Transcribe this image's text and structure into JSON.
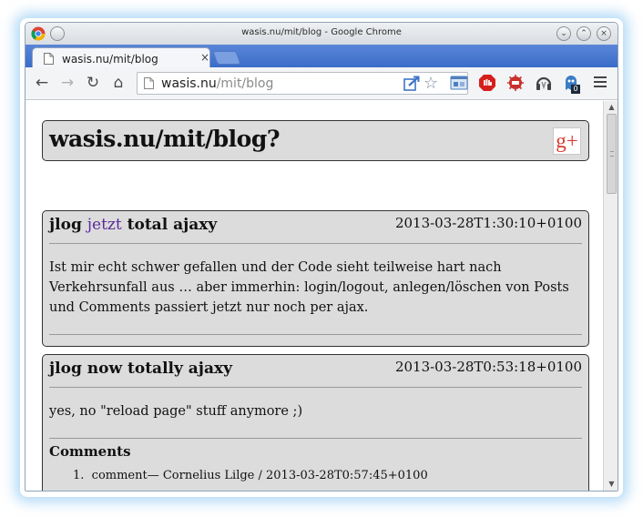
{
  "window": {
    "title": "wasis.nu/mit/blog - Google Chrome",
    "buttons": {
      "minimize": "⌄",
      "maximize": "⌃",
      "close": "×"
    }
  },
  "tab": {
    "label": "wasis.nu/mit/blog",
    "close": "×"
  },
  "toolbar": {
    "back": "←",
    "forward": "→",
    "reload": "↻",
    "home": "⌂",
    "url_host": "wasis.nu",
    "url_path": "/mit/blog",
    "star": "☆",
    "extensions": [
      "gallery-icon",
      "adblock-icon",
      "bug-icon",
      "headphones-icon",
      "ghostery-icon"
    ],
    "badge_count": "0"
  },
  "page": {
    "site_title": "wasis.nu/mit/blog?",
    "gplus_label": "g+",
    "posts": [
      {
        "title_start": "jlog ",
        "title_link": "jetzt",
        "title_end": " total ajaxy",
        "date": "2013-03-28T1:30:10+0100",
        "body": "Ist mir echt schwer gefallen und der Code sieht teilweise hart nach Verkehrsunfall aus … aber immerhin: login/logout, anlegen/löschen von Posts und Comments passiert jetzt nur noch per ajax."
      },
      {
        "title": "jlog now totally ajaxy",
        "date": "2013-03-28T0:53:18+0100",
        "body": "yes, no \"reload page\" stuff anymore ;)",
        "comments_heading": "Comments",
        "comments": [
          {
            "number": "1.",
            "text": "comment— Cornelius Lilge / 2013-03-28T0:57:45+0100"
          }
        ]
      }
    ]
  },
  "colors": {
    "tabstrip": "#3a6cc8",
    "post_background": "#dcdcdc",
    "link": "#5a2a9a",
    "gplus": "#d73d32"
  }
}
